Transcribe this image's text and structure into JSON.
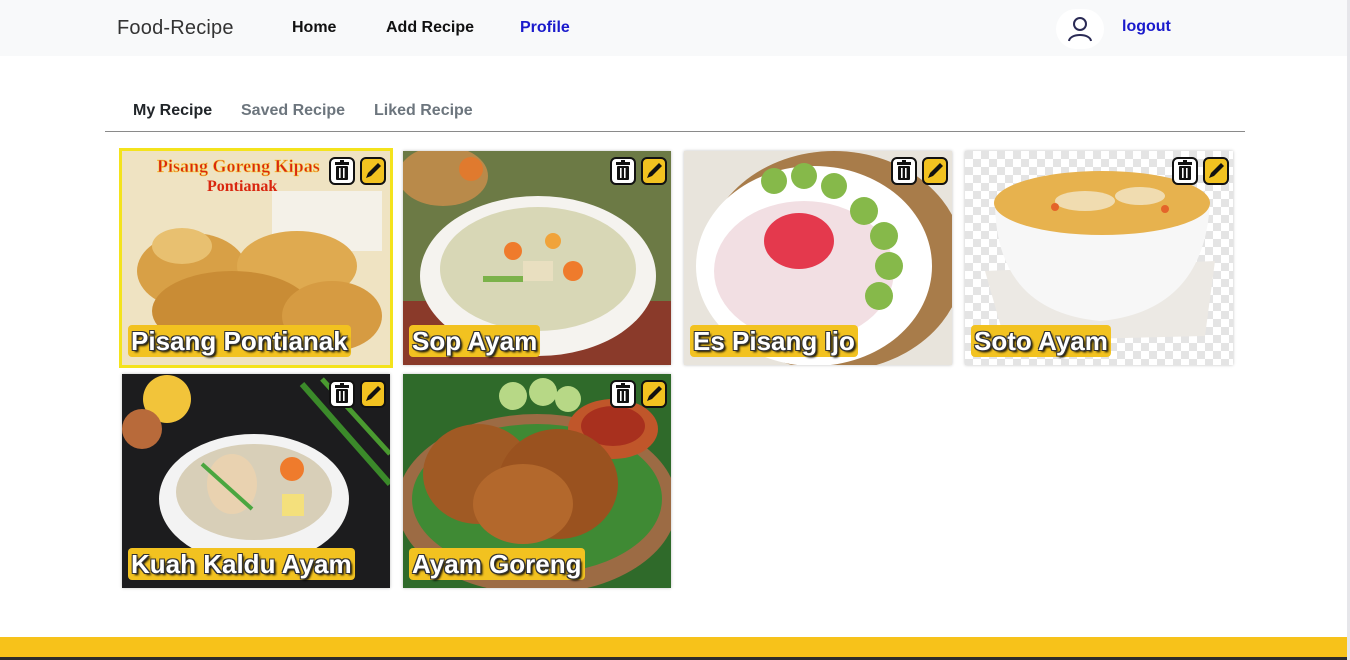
{
  "navbar": {
    "brand": "Food-Recipe",
    "links": [
      "Home",
      "Add Recipe",
      "Profile"
    ],
    "active_link": "Profile",
    "logout": "logout",
    "accent": "#1a1acc"
  },
  "tabs": [
    {
      "label": "My Recipe",
      "active": true
    },
    {
      "label": "Saved Recipe",
      "active": false
    },
    {
      "label": "Liked Recipe",
      "active": false
    }
  ],
  "recipes": [
    {
      "title": "Pisang Pontianak",
      "image_caption": "Pisang Goreng Kipas Pontianak",
      "selected": true
    },
    {
      "title": "Sop Ayam"
    },
    {
      "title": "Es Pisang Ijo"
    },
    {
      "title": "Soto Ayam"
    },
    {
      "title": "Kuah Kaldu Ayam"
    },
    {
      "title": "Ayam Goreng"
    }
  ],
  "card_icons": {
    "delete": "trash-icon",
    "edit": "pencil-icon"
  },
  "colors": {
    "footer": "#f7c21a",
    "title_badge": "#f2c220",
    "selected_border": "#f4e31c"
  }
}
